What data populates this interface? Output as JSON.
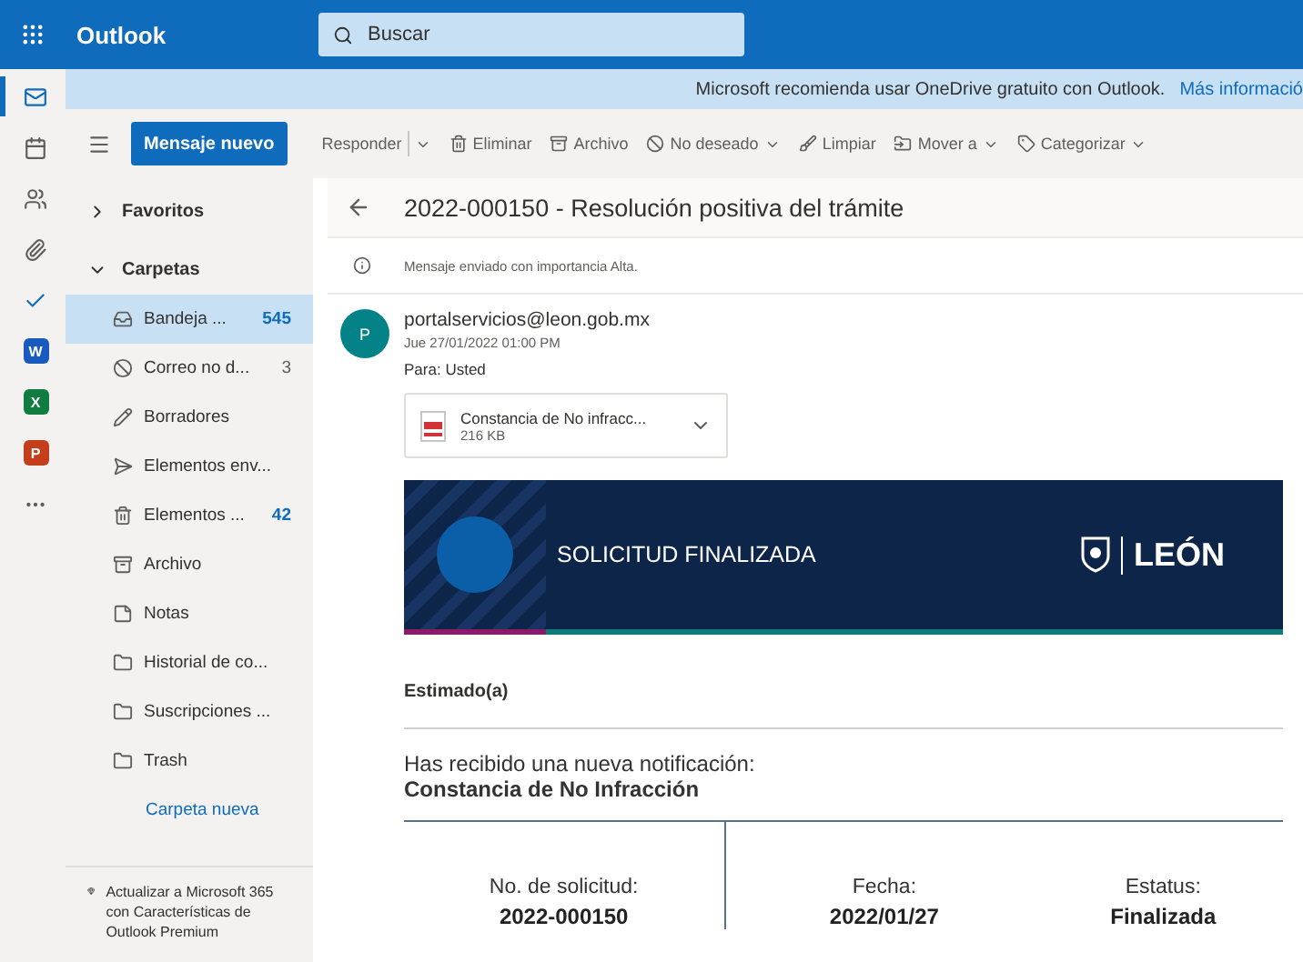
{
  "topbar": {
    "app_name": "Outlook",
    "search": {
      "placeholder": "Buscar"
    }
  },
  "rail": [
    {
      "kind": "mail",
      "selected": true
    },
    {
      "kind": "calendar",
      "selected": false
    },
    {
      "kind": "people",
      "selected": false
    },
    {
      "kind": "attach",
      "selected": false
    },
    {
      "kind": "todo",
      "selected": false
    },
    {
      "kind": "app",
      "letter": "W",
      "color": "#185abd"
    },
    {
      "kind": "app",
      "letter": "X",
      "color": "#107c41"
    },
    {
      "kind": "app",
      "letter": "P",
      "color": "#c43e1c"
    },
    {
      "kind": "more",
      "selected": false
    }
  ],
  "notice": {
    "text": "Microsoft recomienda usar OneDrive gratuito con Outlook.",
    "link": "Más informació"
  },
  "new_message": "Mensaje nuevo",
  "toolbar": [
    {
      "label": "Responder",
      "kind": "reply"
    },
    {
      "label": "Eliminar",
      "kind": "trash"
    },
    {
      "label": "Archivo",
      "kind": "archive"
    },
    {
      "label": "No deseado",
      "kind": "junk"
    },
    {
      "label": "Limpiar",
      "kind": "sweep"
    },
    {
      "label": "Mover a",
      "kind": "move"
    },
    {
      "label": "Categorizar",
      "kind": "tag"
    }
  ],
  "sections": [
    {
      "label": "Favoritos",
      "expanded": false
    },
    {
      "label": "Carpetas",
      "expanded": true
    }
  ],
  "folders": [
    {
      "label": "Bandeja ...",
      "kind": "inbox",
      "count": "545",
      "selected": true,
      "unread": true
    },
    {
      "label": "Correo no d...",
      "kind": "junk",
      "count": "3",
      "selected": false,
      "unread": false
    },
    {
      "label": "Borradores",
      "kind": "drafts",
      "selected": false
    },
    {
      "label": "Elementos env...",
      "kind": "sent",
      "selected": false
    },
    {
      "label": "Elementos ...",
      "kind": "deleted",
      "count": "42",
      "selected": false,
      "unread": true
    },
    {
      "label": "Archivo",
      "kind": "archive",
      "selected": false
    },
    {
      "label": "Notas",
      "kind": "notes",
      "selected": false
    },
    {
      "label": "Historial de co...",
      "kind": "folder",
      "selected": false
    },
    {
      "label": "Suscripciones ...",
      "kind": "folder",
      "selected": false
    },
    {
      "label": "Trash",
      "kind": "folder",
      "selected": false
    }
  ],
  "new_folder": "Carpeta nueva",
  "upgrade": "Actualizar a Microsoft 365 con Características de Outlook Premium",
  "message": {
    "subject": "2022-000150 - Resolución positiva del trámite",
    "importance": "Mensaje enviado con importancia Alta.",
    "avatar": "P",
    "sender": "portalservicios@leon.gob.mx",
    "date": "Jue 27/01/2022 01:00 PM",
    "to_label": "Para:",
    "to": "Usted",
    "attachment": {
      "kind": "pdf",
      "name": "Constancia de No infracc...",
      "size": "216 KB"
    },
    "banner": {
      "title": "SOLICITUD FINALIZADA",
      "logo_text": "LEÓN"
    },
    "greeting": "Estimado(a)",
    "notification": "Has recibido una nueva notificación:",
    "notification_subject": "Constancia de No Infracción",
    "fields": [
      {
        "label": "No. de solicitud:",
        "value": "2022-000150"
      },
      {
        "label": "Fecha:",
        "value": "2022/01/27"
      },
      {
        "label": "Estatus:",
        "value": "Finalizada"
      }
    ]
  }
}
